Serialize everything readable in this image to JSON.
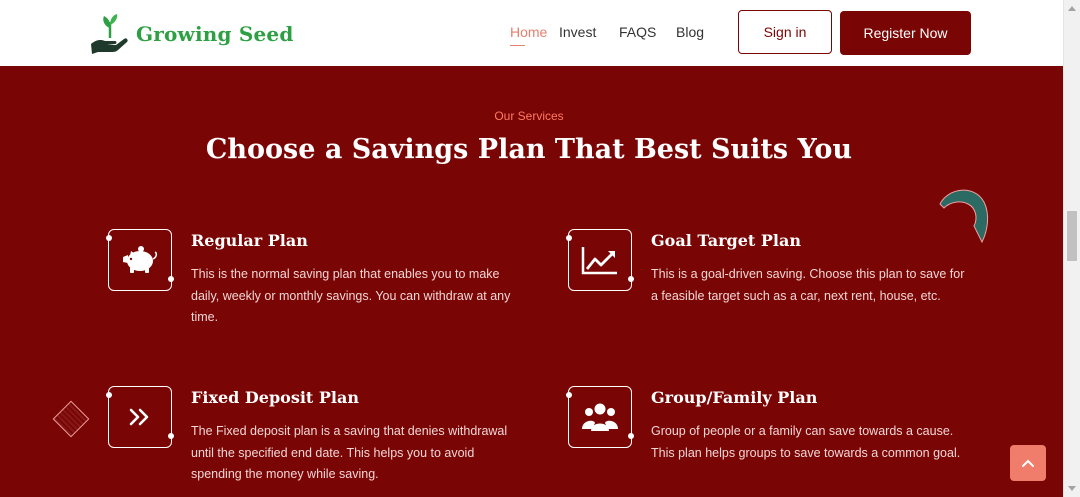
{
  "brand": {
    "name": "Growing Seed",
    "icon": "hand-sprout-icon"
  },
  "nav": {
    "items": [
      {
        "label": "Home",
        "active": true
      },
      {
        "label": "Invest",
        "active": false
      },
      {
        "label": "FAQS",
        "active": false
      },
      {
        "label": "Blog",
        "active": false
      }
    ],
    "signin_label": "Sign in",
    "register_label": "Register Now"
  },
  "services": {
    "eyebrow": "Our Services",
    "heading": "Choose a Savings Plan That Best Suits You",
    "plans": [
      {
        "title": "Regular Plan",
        "icon": "piggy-bank-icon",
        "description": "This is the normal saving plan that enables you to make daily, weekly or monthly savings. You can withdraw at any time."
      },
      {
        "title": "Goal Target Plan",
        "icon": "chart-line-icon",
        "description": "This is a goal-driven saving. Choose this plan to save for a feasible target such as a car, next rent, house, etc."
      },
      {
        "title": "Fixed Deposit Plan",
        "icon": "double-chevron-right-icon",
        "description": "The Fixed deposit plan is a saving that denies withdrawal until the specified end date. This helps you to avoid spending the money while saving."
      },
      {
        "title": "Group/Family Plan",
        "icon": "users-group-icon",
        "description": "Group of people or a family can save towards a cause. This plan helps groups to save towards a common goal."
      }
    ]
  },
  "colors": {
    "primary": "#7a0505",
    "accent": "#f07d6c",
    "brand_green": "#2ea043",
    "teal": "#2b6b64"
  },
  "scroll_top_icon": "chevron-up-icon"
}
